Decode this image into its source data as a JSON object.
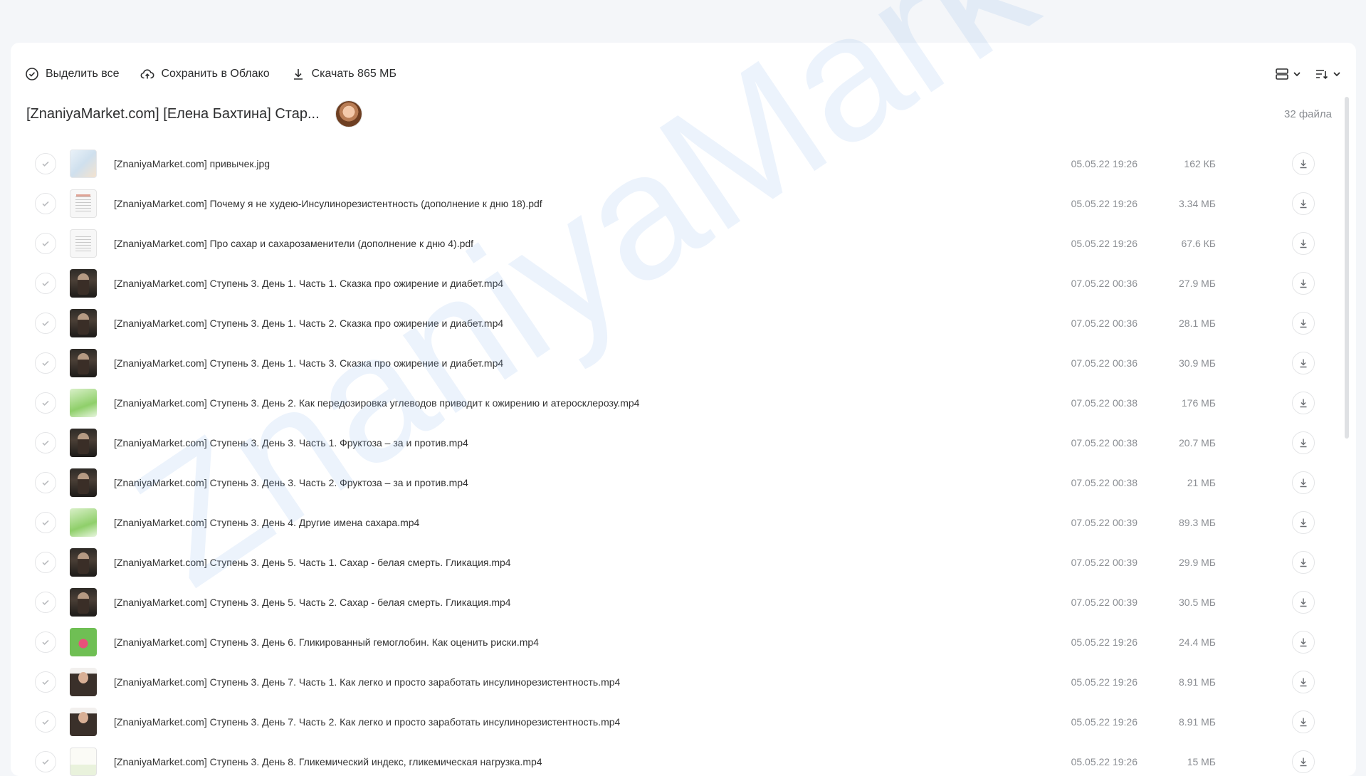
{
  "toolbar": {
    "select_all": "Выделить все",
    "save_to_cloud": "Сохранить в Облако",
    "download": "Скачать 865 МБ"
  },
  "folder": {
    "title": "[ZnaniyaMarket.com] [Елена Бахтина] Стар...",
    "file_count": "32 файла"
  },
  "watermark": "ZnaniyaMarket.club",
  "files": [
    {
      "name": "[ZnaniyaMarket.com] привычек.jpg",
      "date": "05.05.22 19:26",
      "size": "162 КБ",
      "thumb": "image"
    },
    {
      "name": "[ZnaniyaMarket.com] Почему я не худею-Инсулинорезистентность (дополнение к дню 18).pdf",
      "date": "05.05.22 19:26",
      "size": "3.34 МБ",
      "thumb": "pdf-red"
    },
    {
      "name": "[ZnaniyaMarket.com] Про сахар и сахарозаменители (дополнение к дню 4).pdf",
      "date": "05.05.22 19:26",
      "size": "67.6 КБ",
      "thumb": "pdf"
    },
    {
      "name": "[ZnaniyaMarket.com] Ступень 3. День 1. Часть 1. Сказка про ожирение и диабет.mp4",
      "date": "07.05.22 00:36",
      "size": "27.9 МБ",
      "thumb": "video"
    },
    {
      "name": "[ZnaniyaMarket.com] Ступень 3. День 1. Часть 2. Сказка про ожирение и диабет.mp4",
      "date": "07.05.22 00:36",
      "size": "28.1 МБ",
      "thumb": "video"
    },
    {
      "name": "[ZnaniyaMarket.com] Ступень 3. День 1. Часть 3. Сказка про ожирение и диабет.mp4",
      "date": "07.05.22 00:36",
      "size": "30.9 МБ",
      "thumb": "video"
    },
    {
      "name": "[ZnaniyaMarket.com] Ступень 3. День 2. Как передозировка углеводов приводит к ожирению и атеросклерозу.mp4",
      "date": "07.05.22 00:38",
      "size": "176 МБ",
      "thumb": "green"
    },
    {
      "name": "[ZnaniyaMarket.com] Ступень 3. День 3. Часть 1. Фруктоза – за и против.mp4",
      "date": "07.05.22 00:38",
      "size": "20.7 МБ",
      "thumb": "video"
    },
    {
      "name": "[ZnaniyaMarket.com] Ступень 3. День 3. Часть 2. Фруктоза – за и против.mp4",
      "date": "07.05.22 00:38",
      "size": "21 МБ",
      "thumb": "video"
    },
    {
      "name": "[ZnaniyaMarket.com] Ступень 3. День 4. Другие имена сахара.mp4",
      "date": "07.05.22 00:39",
      "size": "89.3 МБ",
      "thumb": "green"
    },
    {
      "name": "[ZnaniyaMarket.com] Ступень 3. День 5. Часть 1. Сахар - белая смерть. Гликация.mp4",
      "date": "07.05.22 00:39",
      "size": "29.9 МБ",
      "thumb": "video"
    },
    {
      "name": "[ZnaniyaMarket.com] Ступень 3. День 5. Часть 2. Сахар - белая смерть. Гликация.mp4",
      "date": "07.05.22 00:39",
      "size": "30.5 МБ",
      "thumb": "video"
    },
    {
      "name": "[ZnaniyaMarket.com] Ступень 3. День 6. Гликированный гемоглобин. Как оценить риски.mp4",
      "date": "05.05.22 19:26",
      "size": "24.4 МБ",
      "thumb": "flower"
    },
    {
      "name": "[ZnaniyaMarket.com] Ступень 3. День 7. Часть 1. Как легко и просто заработать инсулинорезистентность.mp4",
      "date": "05.05.22 19:26",
      "size": "8.91 МБ",
      "thumb": "person"
    },
    {
      "name": "[ZnaniyaMarket.com] Ступень 3. День 7. Часть 2. Как легко и просто заработать инсулинорезистентность.mp4",
      "date": "05.05.22 19:26",
      "size": "8.91 МБ",
      "thumb": "person"
    },
    {
      "name": "[ZnaniyaMarket.com] Ступень 3. День 8. Гликемический индекс, гликемическая нагрузка.mp4",
      "date": "05.05.22 19:26",
      "size": "15 МБ",
      "thumb": "chart"
    }
  ]
}
